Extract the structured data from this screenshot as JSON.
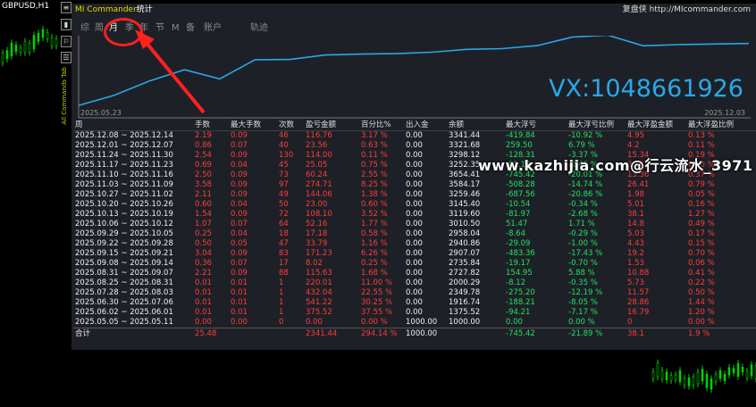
{
  "chart_window": {
    "symbol": "GBPUSD,H1",
    "left_buttons": [
      "≡",
      "▮",
      "⚐",
      "☰"
    ],
    "vertical_text": "All Commands Tab"
  },
  "panel": {
    "app_name": "MI Commander",
    "title_suffix": "统计",
    "link_text": "复盘侠 http://MIcommander.com",
    "tabs": [
      {
        "label": "综",
        "active": false
      },
      {
        "label": "周",
        "active": false
      },
      {
        "label": "月",
        "active": true
      },
      {
        "label": "季",
        "active": false
      },
      {
        "label": "年",
        "active": false
      },
      {
        "label": "节",
        "active": false
      },
      {
        "label": "M",
        "active": false
      },
      {
        "label": "备",
        "active": false
      },
      {
        "label": "账户",
        "active": false
      },
      {
        "label": "轨迹",
        "active": false
      }
    ],
    "watermark_vx": "VX:1048661926",
    "watermark_site": "www.kazhijia.com@行云流水_3971",
    "curve_start_date": "2025.05.23",
    "curve_end_date": "2025.12.03",
    "accent_color": "#2aa7e8"
  },
  "table": {
    "headers": [
      "周",
      "手数",
      "最大手数",
      "次数",
      "盈亏金额",
      "百分比%",
      "出入金",
      "余额",
      "最大浮亏",
      "最大浮亏比例",
      "最大浮盈金额",
      "最大浮盈比例"
    ],
    "rows": [
      [
        "2025.12.08 ~ 2025.12.14",
        "2.19",
        "0.09",
        "46",
        "116.76",
        "3.17 %",
        "0.00",
        "3341.44",
        "-419.84",
        "-10.92 %",
        "4.95",
        "0.13 %"
      ],
      [
        "2025.12.01 ~ 2025.12.07",
        "0.86",
        "0.07",
        "40",
        "23.56",
        "0.63 %",
        "0.00",
        "3321.68",
        "259.50",
        "6.79 %",
        "4.2",
        "0.11 %"
      ],
      [
        "2025.11.24 ~ 2025.11.30",
        "2.54",
        "0.09",
        "130",
        "114.00",
        "0.11 %",
        "0.00",
        "3298.12",
        "-128.31",
        "-3.37 %",
        "15.34",
        "0.19 %"
      ],
      [
        "2025.11.17 ~ 2025.11.23",
        "0.69",
        "0.04",
        "45",
        "25.05",
        "0.75 %",
        "0.00",
        "3252.35",
        "-81.12",
        "-2.45 %",
        "3.16",
        "0.10 %"
      ],
      [
        "2025.11.10 ~ 2025.11.16",
        "2.50",
        "0.09",
        "73",
        "60.24",
        "2.55 %",
        "0.00",
        "3654.41",
        "-745.42",
        "-20.01 %",
        "13.36",
        "0.37 %"
      ],
      [
        "2025.11.03 ~ 2025.11.09",
        "3.58",
        "0.09",
        "97",
        "274.71",
        "8.25 %",
        "0.00",
        "3584.17",
        "-508.28",
        "-14.74 %",
        "26.41",
        "0.79 %"
      ],
      [
        "2025.10.27 ~ 2025.11.02",
        "2.11",
        "0.09",
        "49",
        "144.06",
        "1.38 %",
        "0.00",
        "3259.46",
        "-687.56",
        "-20.86 %",
        "1.98",
        "0.05 %"
      ],
      [
        "2025.10.20 ~ 2025.10.26",
        "0.60",
        "0.04",
        "50",
        "23.00",
        "0.60 %",
        "0.00",
        "3145.40",
        "-10.54",
        "-0.34 %",
        "5.01",
        "0.16 %"
      ],
      [
        "2025.10.13 ~ 2025.10.19",
        "1.54",
        "0.09",
        "72",
        "108.10",
        "3.52 %",
        "0.00",
        "3119.60",
        "-81.97",
        "-2.68 %",
        "38.1",
        "1.27 %"
      ],
      [
        "2025.10.06 ~ 2025.10.12",
        "1.07",
        "0.07",
        "64",
        "52.16",
        "1.77 %",
        "0.00",
        "3010.50",
        "51.47",
        "1.71 %",
        "14.8",
        "0.49 %"
      ],
      [
        "2025.09.29 ~ 2025.10.05",
        "0.25",
        "0.04",
        "18",
        "17.18",
        "0.58 %",
        "0.00",
        "2958.04",
        "-8.64",
        "-0.29 %",
        "5.03",
        "0.17 %"
      ],
      [
        "2025.09.22 ~ 2025.09.28",
        "0.50",
        "0.05",
        "47",
        "33.79",
        "1.16 %",
        "0.00",
        "2940.86",
        "-29.09",
        "-1.00 %",
        "4.43",
        "0.15 %"
      ],
      [
        "2025.09.15 ~ 2025.09.21",
        "3.04",
        "0.09",
        "83",
        "171.23",
        "6.26 %",
        "0.00",
        "2907.07",
        "-483.36",
        "-17.43 %",
        "19.2",
        "0.70 %"
      ],
      [
        "2025.09.08 ~ 2025.09.14",
        "0.36",
        "0.07",
        "17",
        "8.02",
        "0.25 %",
        "0.00",
        "2735.84",
        "-19.17",
        "-0.70 %",
        "1.53",
        "0.06 %"
      ],
      [
        "2025.08.31 ~ 2025.09.07",
        "2.21",
        "0.09",
        "88",
        "115.63",
        "1.68 %",
        "0.00",
        "2727.82",
        "154.95",
        "5.88 %",
        "10.88",
        "0.41 %"
      ],
      [
        "2025.08.25 ~ 2025.08.31",
        "0.01",
        "0.01",
        "1",
        "220.01",
        "11.00 %",
        "0.00",
        "2000.29",
        "-8.12",
        "-0.35 %",
        "5.73",
        "0.22 %"
      ],
      [
        "2025.07.28 ~ 2025.08.03",
        "0.01",
        "0.01",
        "1",
        "432.04",
        "22.55 %",
        "0.00",
        "2349.78",
        "-275.20",
        "-12.19 %",
        "11.57",
        "0.50 %"
      ],
      [
        "2025.06.30 ~ 2025.07.06",
        "0.01",
        "0.01",
        "1",
        "541.22",
        "30.25 %",
        "0.00",
        "1916.74",
        "-188.21",
        "-8.05 %",
        "28.86",
        "1.44 %"
      ],
      [
        "2025.06.02 ~ 2025.06.01",
        "0.01",
        "0.01",
        "1",
        "375.52",
        "37.55 %",
        "0.00",
        "1375.52",
        "-94.21",
        "-7.17 %",
        "16.79",
        "1.20 %"
      ],
      [
        "2025.05.05 ~ 2025.05.11",
        "0.00",
        "0.00",
        "0",
        "0.00",
        "0.00 %",
        "1000.00",
        "1000.00",
        "0.00",
        "0.00 %",
        "0",
        "0.00 %"
      ]
    ],
    "row_colors": [
      [
        "w",
        "r",
        "r",
        "r",
        "r",
        "r",
        "w",
        "w",
        "g",
        "g",
        "r",
        "r"
      ]
    ],
    "total": [
      "合计",
      "25.48",
      "",
      "",
      "2341.44",
      "294.14 %",
      "1000.00",
      "",
      "-745.42",
      "-21.89 %",
      "38.1",
      "1.9 %"
    ]
  }
}
